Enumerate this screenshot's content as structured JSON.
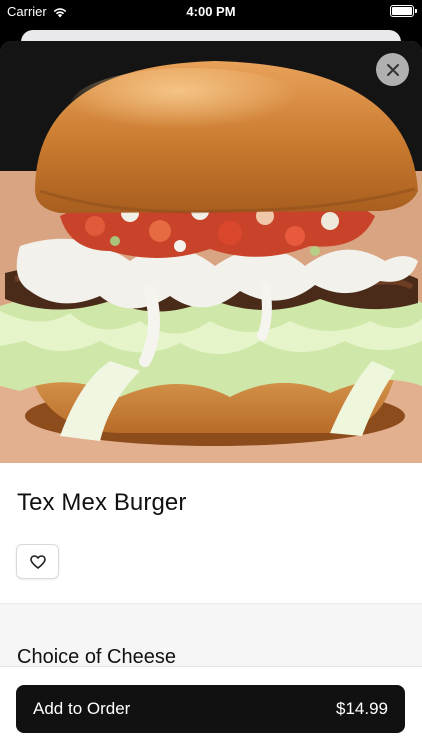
{
  "status_bar": {
    "carrier": "Carrier",
    "time": "4:00 PM"
  },
  "item": {
    "name": "Tex Mex Burger",
    "image_subject": "Tex Mex burger with steak, pico de gallo, cheese sauce and shredded lettuce on a brioche bun"
  },
  "sections": [
    {
      "title": "Choice of Cheese"
    }
  ],
  "order_button": {
    "label": "Add to Order",
    "price": "$14.99"
  },
  "icons": {
    "close": "close-icon",
    "favorite": "heart-icon",
    "wifi": "wifi-icon",
    "battery": "battery-icon"
  },
  "colors": {
    "button_background": "#111111",
    "button_text": "#ffffff",
    "section_background": "#f6f6f6"
  }
}
